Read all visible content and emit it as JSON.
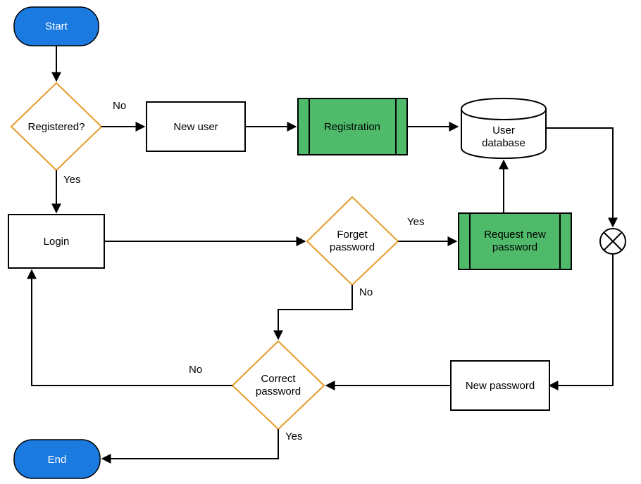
{
  "nodes": {
    "start": "Start",
    "end": "End",
    "registered": "Registered?",
    "new_user": "New user",
    "registration": "Registration",
    "user_db_l1": "User",
    "user_db_l2": "database",
    "login": "Login",
    "forget_l1": "Forget",
    "forget_l2": "password",
    "request_l1": "Request new",
    "request_l2": "password",
    "new_password": "New password",
    "correct_l1": "Correct",
    "correct_l2": "password"
  },
  "labels": {
    "registered_no": "No",
    "registered_yes": "Yes",
    "forget_yes": "Yes",
    "forget_no": "No",
    "correct_no": "No",
    "correct_yes": "Yes"
  }
}
